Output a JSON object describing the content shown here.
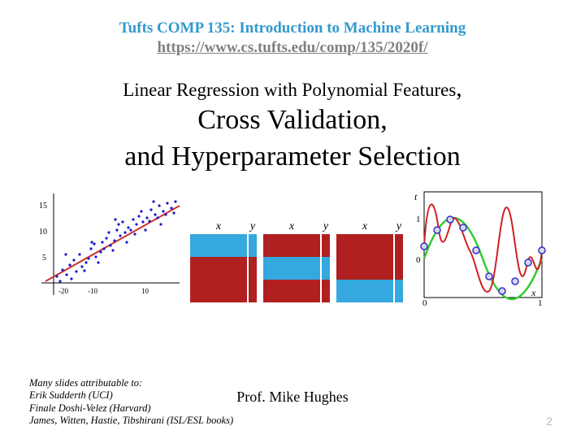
{
  "header": {
    "course": "Tufts COMP 135: Introduction to Machine Learning",
    "url": "https://www.cs.tufts.edu/comp/135/2020f/"
  },
  "title": {
    "subtitle_part": "Linear Regression with Polynomial Features",
    "line1": "Cross Validation,",
    "line2": "and Hyperparameter Selection"
  },
  "cv_labels": {
    "x": "x",
    "y": "y"
  },
  "footer": {
    "credits_header": "Many slides attributable to:",
    "credit1": "Erik Sudderth (UCI)",
    "credit2": "Finale Doshi-Velez (Harvard)",
    "credit3": "James, Witten, Hastie, Tibshirani (ISL/ESL books)",
    "prof": "Prof. Mike Hughes",
    "page": "2"
  },
  "chart_data": [
    {
      "type": "scatter",
      "title": "Linear regression scatter",
      "xlabel": "",
      "ylabel": "",
      "xlim": [
        -25,
        20
      ],
      "ylim": [
        0,
        17
      ],
      "x_ticks": [
        -20,
        -10,
        10
      ],
      "y_ticks": [
        5,
        10,
        15
      ],
      "fit_line": {
        "p1": [
          -25,
          2
        ],
        "p2": [
          20,
          14
        ]
      },
      "note": "approx 80 blue points, positive slope red fit line"
    },
    {
      "type": "table",
      "title": "3-fold cross-validation split",
      "folds": [
        {
          "x": [
            "test",
            "train",
            "train"
          ],
          "y": [
            "test",
            "train",
            "train"
          ]
        },
        {
          "x": [
            "train",
            "test",
            "train"
          ],
          "y": [
            "train",
            "test",
            "train"
          ]
        },
        {
          "x": [
            "train",
            "train",
            "test"
          ],
          "y": [
            "train",
            "train",
            "test"
          ]
        }
      ],
      "colors": {
        "train": "#b02020",
        "test": "#35a8e0"
      }
    },
    {
      "type": "line",
      "title": "Polynomial overfit curves",
      "xlabel": "x",
      "ylabel": "t",
      "xlim": [
        0,
        1
      ],
      "ylim": [
        -1.2,
        1.4
      ],
      "x_ticks": [
        0,
        1
      ],
      "y_ticks": [
        0,
        1
      ],
      "series": [
        {
          "name": "data points (blue circles)",
          "x": [
            0.0,
            0.11,
            0.22,
            0.33,
            0.44,
            0.55,
            0.66,
            0.77,
            0.88,
            1.0
          ],
          "y": [
            0.35,
            0.8,
            1.0,
            0.85,
            0.25,
            -0.4,
            -0.9,
            -0.8,
            -0.1,
            0.2
          ]
        },
        {
          "name": "true sine (green)",
          "note": "sin(2*pi*x)"
        },
        {
          "name": "high-degree poly fit (red)",
          "note": "passes through all points, oscillates wildly beyond data"
        }
      ]
    }
  ]
}
